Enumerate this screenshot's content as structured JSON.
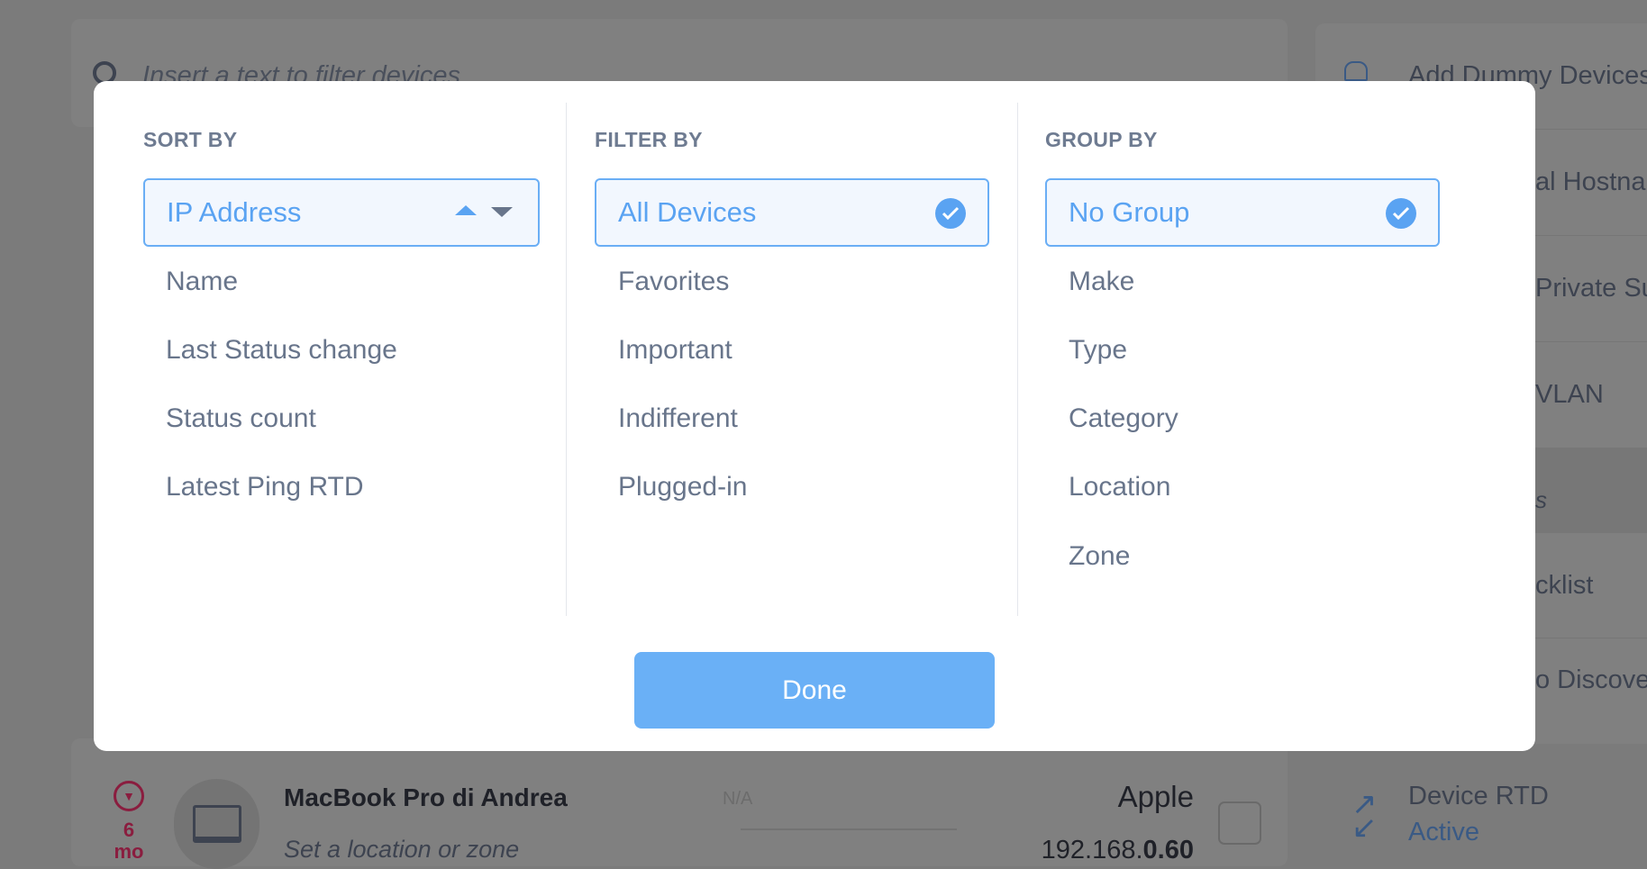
{
  "background": {
    "search_placeholder": "Insert a text to filter devices",
    "side_items": [
      "Add Dummy Devices",
      "al Hostnar",
      "Private Sub",
      "VLAN",
      "s",
      "cklist",
      "o Discover"
    ],
    "device": {
      "name": "MacBook Pro di Andrea",
      "location": "Set a location or zone",
      "status_age_num": "6",
      "status_age_unit": "mo",
      "rtd_placeholder": "N/A",
      "make": "Apple",
      "ip_prefix": "192.168.",
      "ip_suffix": "0.60"
    },
    "rtd": {
      "label": "Device RTD",
      "status": "Active"
    }
  },
  "modal": {
    "sort": {
      "header": "SORT BY",
      "selected": "IP Address",
      "options": [
        "Name",
        "Last Status change",
        "Status count",
        "Latest Ping RTD"
      ]
    },
    "filter": {
      "header": "FILTER BY",
      "selected": "All Devices",
      "options": [
        "Favorites",
        "Important",
        "Indifferent",
        "Plugged-in"
      ]
    },
    "group": {
      "header": "GROUP BY",
      "selected": "No Group",
      "options": [
        "Make",
        "Type",
        "Category",
        "Location",
        "Zone"
      ]
    },
    "done_label": "Done"
  },
  "colors": {
    "accent": "#5aa3f2",
    "button": "#6ab0f6",
    "overlay": "#808080",
    "alert": "#8a1d3f"
  }
}
